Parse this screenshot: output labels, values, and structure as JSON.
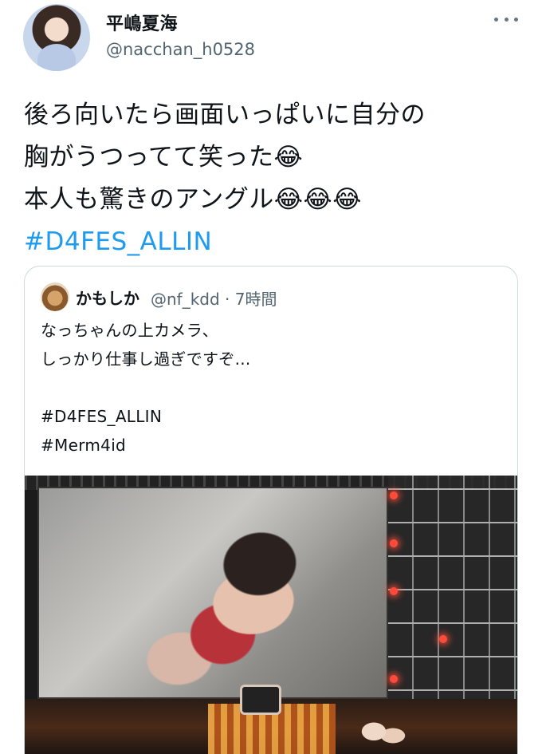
{
  "author": {
    "name": "平嶋夏海",
    "handle": "@nacchan_h0528",
    "more_icon": "more-horizontal-icon"
  },
  "tweet": {
    "lines": [
      "後ろ向いたら画面いっぱいに自分の",
      "胸がうつってて笑った😂",
      "本人も驚きのアングル😂😂😂"
    ],
    "hashtag": "#D4FES_ALLIN"
  },
  "quote": {
    "name": "かもしか",
    "handle": "@nf_kdd · 7時間",
    "lines": [
      "なっちゃんの上カメラ、",
      "しっかり仕事し過ぎですぞ...",
      "",
      "#D4FES_ALLIN",
      "#Merm4id"
    ]
  },
  "colors": {
    "link": "#1d9bf0",
    "secondary_text": "#536471",
    "border": "#cfd9de"
  }
}
